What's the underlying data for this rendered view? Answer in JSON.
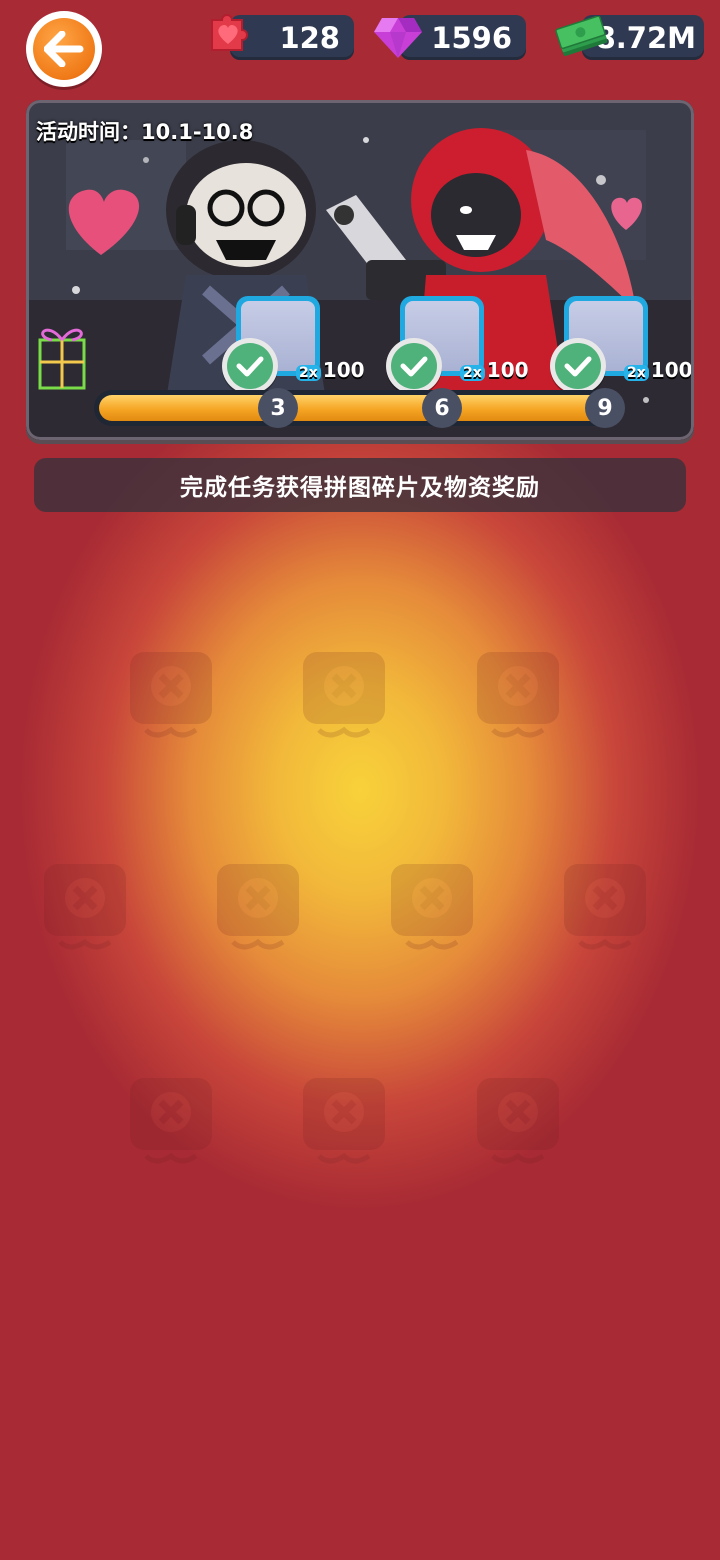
{
  "currencies": {
    "puzzle": {
      "value": "128",
      "icon": "heart-puzzle-icon"
    },
    "gems": {
      "value": "1596",
      "icon": "gem-icon"
    },
    "cash": {
      "value": "8.72M",
      "icon": "cash-stack-icon"
    }
  },
  "banner": {
    "event_time": "活动时间：10.1-10.8",
    "rewards": [
      {
        "multiplier": "2x",
        "qty": "100",
        "claimed": true
      },
      {
        "multiplier": "2x",
        "qty": "100",
        "claimed": true
      },
      {
        "multiplier": "2x",
        "qty": "100",
        "claimed": true
      }
    ],
    "milestones": [
      "3",
      "6",
      "9"
    ],
    "progress": 1.0
  },
  "task_banner": "完成任务获得拼图碎片及物资奖励",
  "colors": {
    "accent": "#f07a18",
    "background": "#a82a34",
    "progress": "#f6a524"
  }
}
